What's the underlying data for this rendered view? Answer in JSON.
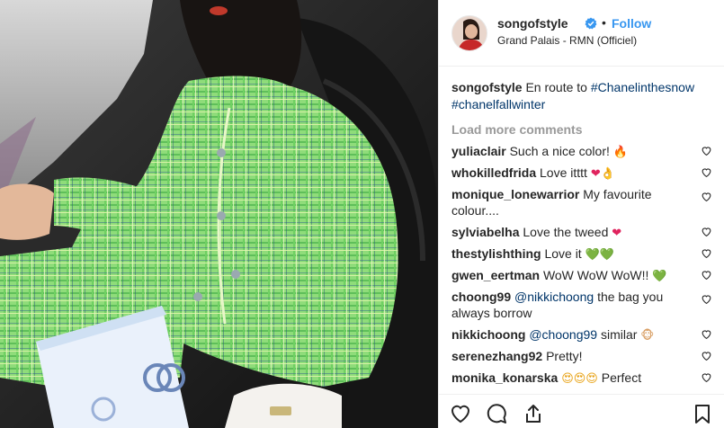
{
  "post": {
    "image_alt": "Photo of a woman in a green tweed suit sitting in a car",
    "header": {
      "username": "songofstyle",
      "dot": "•",
      "follow_label": "Follow",
      "location": "Grand Palais - RMN (Officiel)"
    },
    "caption": {
      "username": "songofstyle",
      "text": "En route to",
      "tags": [
        "#Chanelinthesnow",
        "#chanelfallwinter"
      ]
    },
    "load_more_label": "Load more comments",
    "comments": [
      {
        "username": "yuliaclair",
        "text": "Such a nice color!",
        "emoji": "🔥",
        "emoji_icon": "fire-emoji"
      },
      {
        "username": "whokilledfrida",
        "text": "Love itttt",
        "emoji": "❤👌",
        "emoji_icon": "red-heart-emoji"
      },
      {
        "username": "monique_lonewarrior",
        "text": "My favourite colour....",
        "emoji": "",
        "emoji_icon": ""
      },
      {
        "username": "sylviabelha",
        "text": "Love the tweed",
        "emoji": "❤",
        "emoji_icon": "red-heart-emoji"
      },
      {
        "username": "thestylishthing",
        "text": "Love it",
        "emoji": "💚💚",
        "emoji_icon": "green-heart-emoji"
      },
      {
        "username": "gwen_eertman",
        "text": "WoW WoW WoW!!",
        "emoji": "💚",
        "emoji_icon": "green-heart-emoji"
      },
      {
        "username": "choong99",
        "mention": "@nikkichoong",
        "text": "the bag you always borrow",
        "emoji": "",
        "emoji_icon": ""
      },
      {
        "username": "nikkichoong",
        "mention": "@choong99",
        "text": "similar",
        "emoji": "🐵",
        "emoji_icon": "monkey-emoji"
      },
      {
        "username": "serenezhang92",
        "text": "Pretty!",
        "emoji": "",
        "emoji_icon": ""
      },
      {
        "username": "monika_konarska",
        "text": "Perfect",
        "emoji": "😍😍😍",
        "emoji_icon": "heart-eyes-emoji"
      }
    ],
    "colors": {
      "link_blue": "#3897f0",
      "hashtag": "#003569",
      "muted_grey": "#999999",
      "text": "#262626",
      "border": "#efefef"
    },
    "icons": [
      "verified-badge-icon",
      "like-icon",
      "comment-icon",
      "share-icon",
      "save-icon",
      "comment-like-icon"
    ]
  }
}
